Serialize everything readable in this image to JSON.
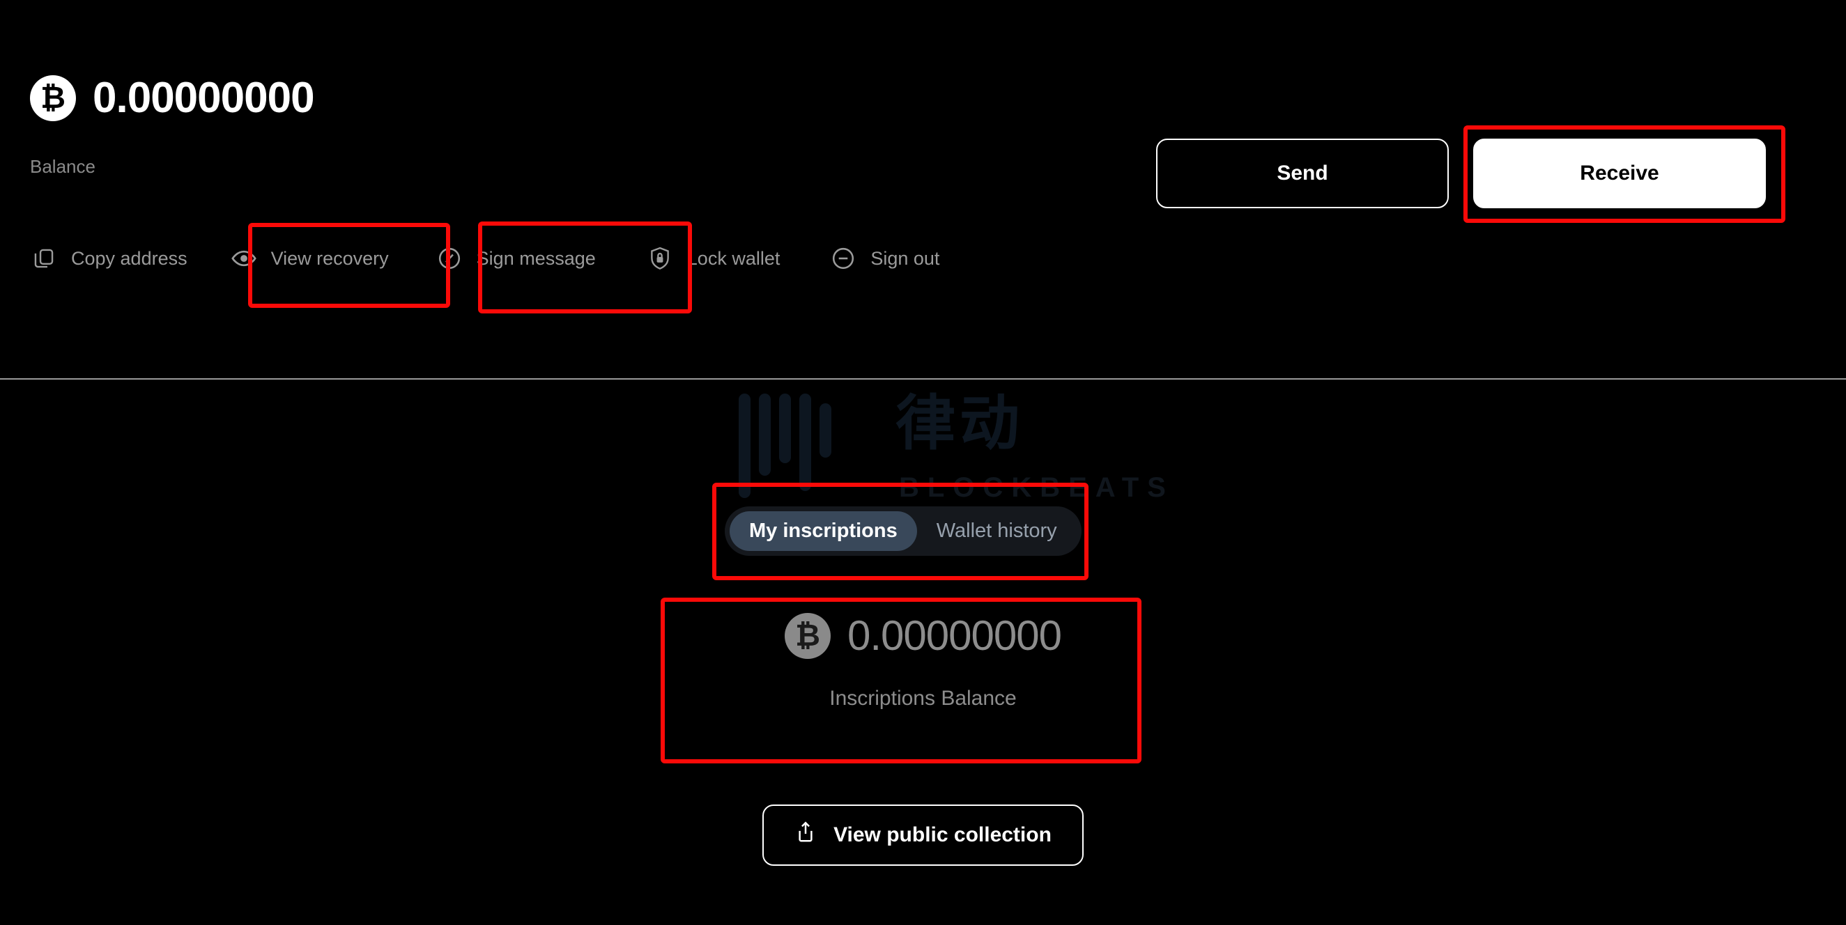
{
  "wallet": {
    "balance_amount": "0.00000000",
    "balance_label": "Balance",
    "coin_symbol": "₿"
  },
  "cta": {
    "send_label": "Send",
    "receive_label": "Receive"
  },
  "actions": [
    {
      "label": "Copy address",
      "icon": "copy-icon"
    },
    {
      "label": "View recovery",
      "icon": "eye-icon"
    },
    {
      "label": "Sign message",
      "icon": "sign-pen-circle-icon"
    },
    {
      "label": "Lock wallet",
      "icon": "shield-lock-icon"
    },
    {
      "label": "Sign out",
      "icon": "minus-circle-icon"
    }
  ],
  "tabs": [
    {
      "label": "My inscriptions",
      "active": true
    },
    {
      "label": "Wallet history",
      "active": false
    }
  ],
  "inscriptions": {
    "amount": "0.00000000",
    "label": "Inscriptions Balance",
    "coin_symbol": "₿"
  },
  "public_collection": {
    "label": "View public collection",
    "icon": "share-export-icon"
  },
  "watermark": {
    "text": "律动",
    "subtitle": "BLOCKBEATS"
  },
  "colors": {
    "background": "#000000",
    "accent_white": "#ffffff",
    "muted_text": "#8d8d8d",
    "tab_active_bg": "#39485a",
    "tab_bar_bg": "#15181d",
    "annotation": "#fb0a08"
  }
}
